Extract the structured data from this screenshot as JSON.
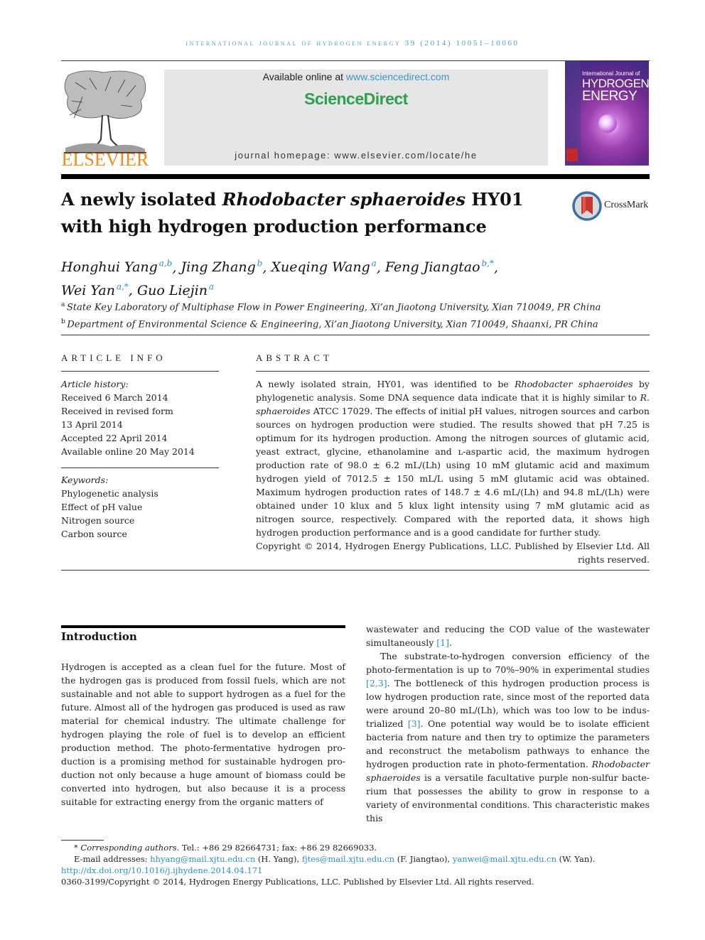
{
  "header": {
    "running_head": "INTERNATIONAL JOURNAL OF HYDROGEN ENERGY 39 (2014) 10051–10060",
    "publisher_logo_text": "ELSEVIER",
    "available_online_prefix": "Available online at ",
    "available_online_link": "www.sciencedirect.com",
    "sciencedirect_brand": "ScienceDirect",
    "journal_homepage": "journal homepage: www.elsevier.com/locate/he",
    "cover": {
      "line1": "International Journal of",
      "line2": "HYDROGEN",
      "line3": "ENERGY"
    },
    "colors": {
      "accent_link": "#2e8fc4",
      "elsevier_orange": "#f28a1e",
      "sciencedirect_green": "#2f9e4e"
    }
  },
  "article": {
    "title_part1": "A newly isolated ",
    "title_italic": "Rhodobacter sphaeroides",
    "title_part2": " HY01",
    "title_line2": "with high hydrogen production performance",
    "crossmark_label": "CrossMark",
    "authors": [
      {
        "name": "Honghui Yang",
        "sup": "a,b"
      },
      {
        "name": "Jing Zhang",
        "sup": "b"
      },
      {
        "name": "Xueqing Wang",
        "sup": "a"
      },
      {
        "name": "Feng Jiangtao",
        "sup": "b,*"
      },
      {
        "name": "Wei Yan",
        "sup": "a,*"
      },
      {
        "name": "Guo Liejin",
        "sup": "a"
      }
    ],
    "affiliations": [
      {
        "key": "a",
        "text": "State Key Laboratory of Multiphase Flow in Power Engineering, Xi’an Jiaotong University, Xian 710049, PR China"
      },
      {
        "key": "b",
        "text": "Department of Environmental Science & Engineering, Xi’an Jiaotong University, Xian 710049, Shaanxi, PR China"
      }
    ]
  },
  "article_info": {
    "heading": "ARTICLE INFO",
    "history_label": "Article history:",
    "history": [
      "Received 6 March 2014",
      "Received in revised form",
      "13 April 2014",
      "Accepted 22 April 2014",
      "Available online 20 May 2014"
    ],
    "keywords_label": "Keywords:",
    "keywords": [
      "Phylogenetic analysis",
      "Effect of pH value",
      "Nitrogen source",
      "Carbon source"
    ]
  },
  "abstract": {
    "heading": "ABSTRACT",
    "s1": "A newly isolated strain, HY01, was identified to be ",
    "s1_italic": "Rhodobacter sphaeroides",
    "s2": " by phylogenetic analysis. Some DNA sequence data indicate that it is highly similar to ",
    "s2_italic": "R. sphaeroides",
    "s3": " ATCC 17029. The effects of initial pH values, nitrogen sources and carbon sources on hydrogen production were studied. The results showed that pH 7.25 is optimum for its hydrogen production. Among the nitrogen sources of glutamic acid, yeast extract, glycine, ethanol­amine and ʟ-aspartic acid, the maximum hydrogen production rate of 98.0 ± 6.2 mL/(Lh) using 10 mM glutamic acid and maximum hydrogen yield of 7012.5 ± 150 mL/L using 5 mM glutamic acid was obtained. Maximum hydrogen production rates of 148.7 ± 4.6 mL/(Lh) and 94.8 mL/(Lh) were obtained under 10 klux and 5 klux light intensity using 7 mM glu­tamic acid as nitrogen source, respectively. Compared with the reported data, it shows high hydrogen production performance and is a good candidate for further study.",
    "copyright": "Copyright © 2014, Hydrogen Energy Publications, LLC. Published by Elsevier Ltd. All rights reserved."
  },
  "introduction": {
    "heading": "Introduction",
    "left_paragraph": "Hydrogen is accepted as a clean fuel for the future. Most of the hydrogen gas is produced from fossil fuels, which are not sustainable and not able to support hydrogen as a fuel for the future. Almost all of the hydrogen gas produced is used as raw material for chemical industry. The ultimate challenge for hydrogen playing the role of fuel is to develop an efficient production method. The photo-fermentative hydrogen pro­duction is a promising method for sustainable hydrogen pro­duction not only because a huge amount of biomass could be converted into hydrogen, but also because it is a process suitable for extracting energy from the organic matters of",
    "right_p1_text": "wastewater and reducing the COD value of the wastewater simultaneously ",
    "right_p1_ref": "[1]",
    "right_p2_a": "The substrate-to-hydrogen conversion efficiency of the photo-fermentation is up to 70%–90% in experimental studies ",
    "right_p2_ref1": "[2,3]",
    "right_p2_b": ". The bottleneck of this hydrogen production process is low hydrogen production rate, since most of the reported data were around 20–80 mL/(Lh), which was too low to be indus­trialized ",
    "right_p2_ref2": "[3]",
    "right_p2_c": ". One potential way would be to isolate efficient bacteria from nature and then try to optimize the parameters and reconstruct the metabolism pathways to enhance the hydrogen production rate in photo-fermentation. ",
    "right_p2_italic1": "Rhodobacter sphaeroides",
    "right_p2_d": " is a versatile facultative purple non-sulfur bacte­rium that possesses the ability to grow in response to a variety of environmental conditions. This characteristic makes this"
  },
  "footnotes": {
    "corresponding_label": "Corresponding authors.",
    "corresponding_contact": " Tel.: +86 29 82664731; fax: +86 29 82669033.",
    "email_label": "E-mail addresses: ",
    "emails": [
      {
        "address": "hhyang@mail.xjtu.edu.cn",
        "owner": " (H. Yang), "
      },
      {
        "address": "fjtes@mail.xjtu.edu.cn",
        "owner": " (F. Jiangtao), "
      },
      {
        "address": "yanwei@mail.xjtu.edu.cn",
        "owner": " (W. Yan)."
      }
    ],
    "doi": "http://dx.doi.org/10.1016/j.ijhydene.2014.04.171",
    "issn_copyright": "0360-3199/Copyright © 2014, Hydrogen Energy Publications, LLC. Published by Elsevier Ltd. All rights reserved."
  }
}
